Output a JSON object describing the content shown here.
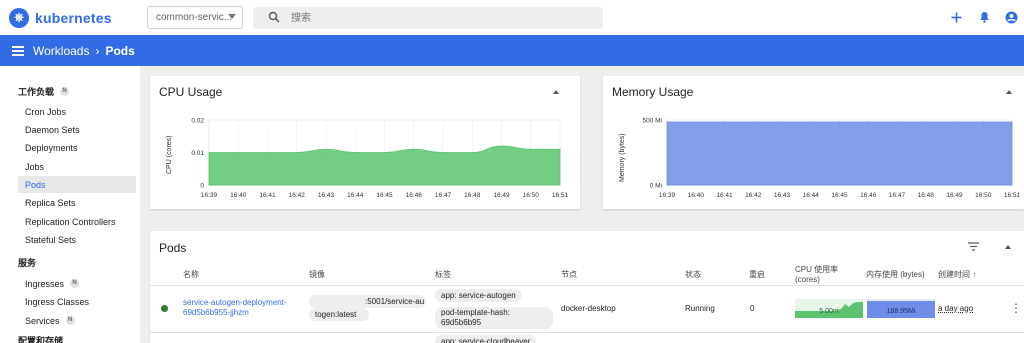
{
  "app": {
    "title": "kubernetes"
  },
  "namespace": {
    "selected": "common-servic..."
  },
  "search": {
    "placeholder": "搜索"
  },
  "header": {
    "crumb_parent": "Workloads",
    "crumb_current": "Pods"
  },
  "sidebar": {
    "section_workloads": "工作负载",
    "section_workloads_badge": "N",
    "items": [
      {
        "label": "Cron Jobs"
      },
      {
        "label": "Daemon Sets"
      },
      {
        "label": "Deployments"
      },
      {
        "label": "Jobs"
      },
      {
        "label": "Pods"
      },
      {
        "label": "Replica Sets"
      },
      {
        "label": "Replication Controllers"
      },
      {
        "label": "Stateful Sets"
      }
    ],
    "section_services": "服务",
    "service_items": [
      {
        "label": "Ingresses",
        "badge": "N"
      },
      {
        "label": "Ingress Classes"
      },
      {
        "label": "Services",
        "badge": "N"
      }
    ],
    "section_config": "配置和存储"
  },
  "cpu_card": {
    "title": "CPU Usage"
  },
  "memory_card": {
    "title": "Memory Usage"
  },
  "chart_data": [
    {
      "type": "area",
      "title": "CPU Usage",
      "ylabel": "CPU (cores)",
      "xlabel": "",
      "x": [
        "16:39",
        "16:40",
        "16:41",
        "16:42",
        "16:43",
        "16:44",
        "16:45",
        "16:46",
        "16:47",
        "16:48",
        "16:49",
        "16:50",
        "16:51"
      ],
      "values": [
        0.01,
        0.01,
        0.01,
        0.01,
        0.011,
        0.01,
        0.01,
        0.011,
        0.01,
        0.01,
        0.012,
        0.011,
        0.011
      ],
      "yticks": [
        "0",
        "0.01",
        "0.02"
      ],
      "ylim": [
        0,
        0.02
      ],
      "color": "#5cc470"
    },
    {
      "type": "area",
      "title": "Memory Usage",
      "ylabel": "Memory (bytes)",
      "xlabel": "",
      "x": [
        "16:39",
        "16:40",
        "16:41",
        "16:42",
        "16:43",
        "16:44",
        "16:45",
        "16:46",
        "16:47",
        "16:48",
        "16:49",
        "16:50",
        "16:51"
      ],
      "values": [
        630,
        630,
        630,
        630,
        630,
        630,
        630,
        630,
        630,
        630,
        630,
        630,
        630
      ],
      "yticks": [
        "0 Mi",
        "500 Mi"
      ],
      "ylim": [
        0,
        650
      ],
      "color": "#6f8de8"
    }
  ],
  "pods": {
    "title": "Pods",
    "columns": [
      "名称",
      "镜像",
      "标签",
      "节点",
      "状态",
      "重启",
      "CPU 使用率 (cores)",
      "内存使用 (bytes)",
      "创建时间 ↑"
    ],
    "rows": [
      {
        "name_line1": "service-autogen-deployment-",
        "name_line2": "69d5b6b955-jjhzm",
        "image_line1": ":5001/service-au",
        "image_line2": "togen:latest",
        "label1": "app: service-autogen",
        "label2_line1": "pod-template-hash: 69d5b6b95",
        "label2_line2": "5",
        "node": "docker-desktop",
        "status": "Running",
        "restarts": "0",
        "cpu": "5.00m",
        "memory": "188.95Mi",
        "created": "a day ago"
      },
      {
        "label1": "app: service-cloudbeaver"
      }
    ]
  },
  "colors": {
    "brand": "#326ce5",
    "cpu": "#5cc470",
    "memory": "#6f8de8",
    "running": "#2e7d32"
  }
}
